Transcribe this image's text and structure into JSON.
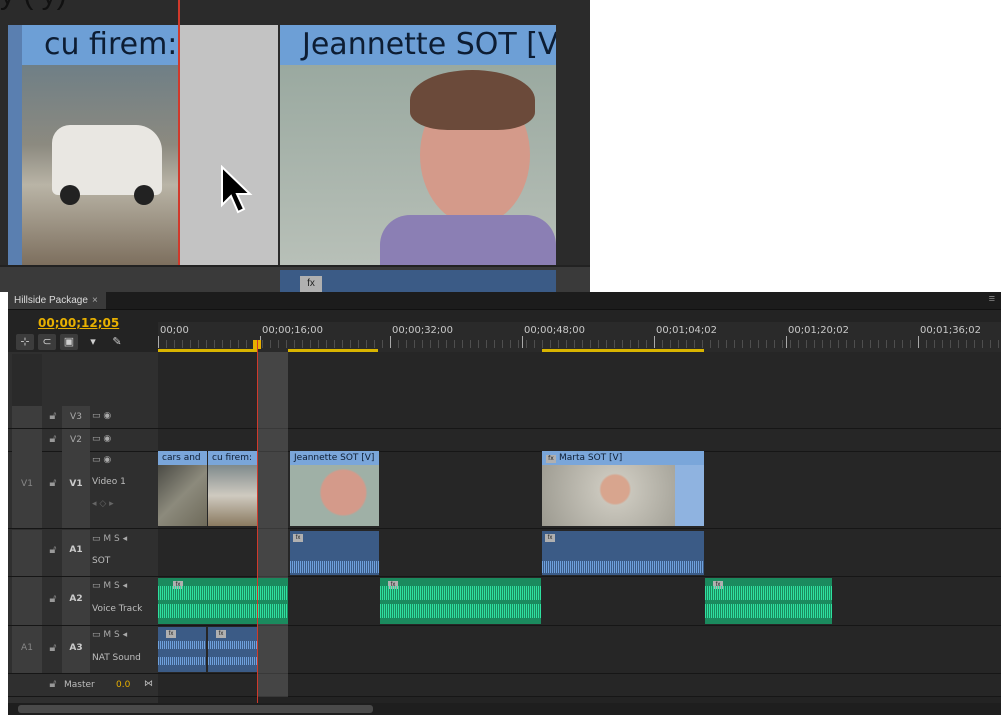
{
  "zoom_preview": {
    "top_text_fragment": "y (                                          y)",
    "clips": [
      {
        "label": "cu firem:"
      },
      {
        "label": "Jeannette SOT [V]"
      }
    ]
  },
  "panel": {
    "tab_title": "Hillside Package",
    "tab_close": "×",
    "menu_icon": "≡",
    "timecode": "00;00;12;05"
  },
  "ruler": {
    "labels": [
      "00;00",
      "00;00;16;00",
      "00;00;32;00",
      "00;00;48;00",
      "00;01;04;02",
      "00;01;20;02",
      "00;01;36;02"
    ]
  },
  "tracks": {
    "v3": {
      "name": "V3"
    },
    "v2": {
      "name": "V2"
    },
    "v1": {
      "source": "V1",
      "name": "V1",
      "label": "Video 1"
    },
    "a1": {
      "name": "A1",
      "label": "SOT",
      "m": "M",
      "s": "S"
    },
    "a2": {
      "name": "A2",
      "label": "Voice Track",
      "m": "M",
      "s": "S"
    },
    "a3": {
      "source": "A1",
      "name": "A3",
      "label": "NAT Sound",
      "m": "M",
      "s": "S"
    },
    "master": {
      "label": "Master",
      "value": "0.0"
    }
  },
  "video_clips": [
    {
      "label": "cars and"
    },
    {
      "label": "cu firem:"
    },
    {
      "label": "Jeannette SOT [V]"
    },
    {
      "label": "Marta SOT [V]"
    }
  ],
  "fx_badge": "fx",
  "colors": {
    "video_clip": "#8fb3e0",
    "audio_blue": "#3b5b86",
    "audio_green": "#1b8a5e",
    "timecode": "#e8b000",
    "playhead": "#d0392b"
  }
}
